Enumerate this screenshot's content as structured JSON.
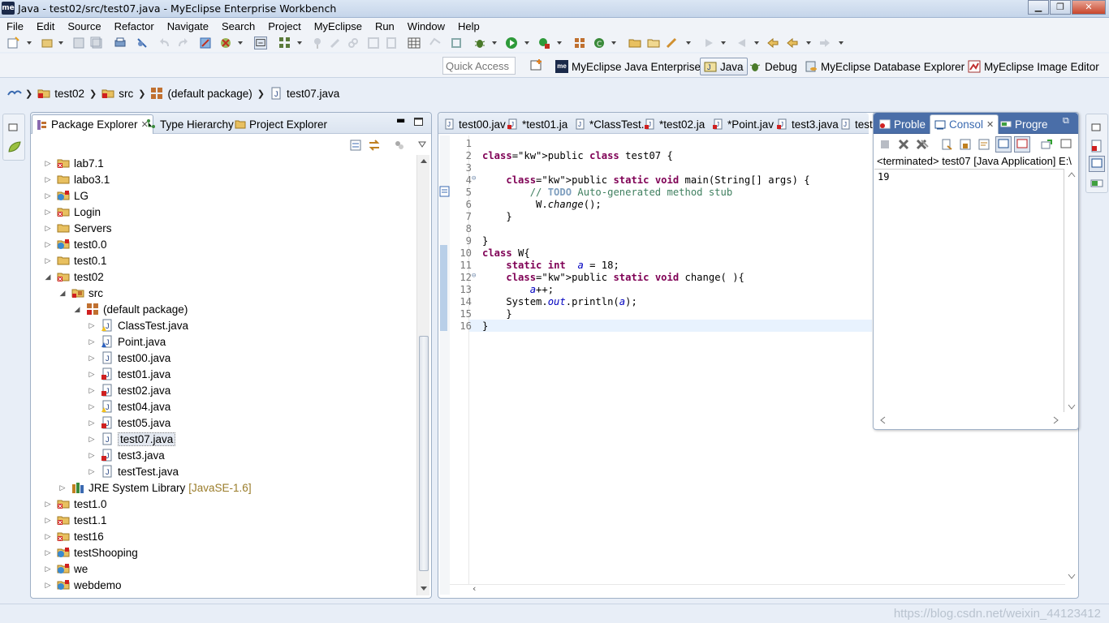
{
  "window": {
    "app_logo": "me",
    "title": "Java - test02/src/test07.java - MyEclipse Enterprise Workbench",
    "minimize": "▁",
    "maximize": "❐",
    "close": "✕"
  },
  "menu": [
    "File",
    "Edit",
    "Source",
    "Refactor",
    "Navigate",
    "Search",
    "Project",
    "MyEclipse",
    "Run",
    "Window",
    "Help"
  ],
  "quick_access": {
    "placeholder": "Quick Access"
  },
  "perspectives": [
    {
      "label": "MyEclipse Java Enterprise",
      "icon": "myeclipse-icon"
    },
    {
      "label": "Java",
      "icon": "java-perspective-icon",
      "active": true
    },
    {
      "label": "Debug",
      "icon": "debug-icon"
    },
    {
      "label": "MyEclipse Database Explorer",
      "icon": "database-icon"
    },
    {
      "label": "MyEclipse Image Editor",
      "icon": "image-editor-icon"
    }
  ],
  "breadcrumb": [
    "test02",
    "src",
    "(default package)",
    "test07.java"
  ],
  "package_explorer": {
    "tabs": [
      "Package Explorer",
      "Type Hierarchy",
      "Project Explorer"
    ],
    "tree": [
      {
        "label": "lab7.1",
        "level": 0,
        "expanded": false,
        "icon": "project-error"
      },
      {
        "label": "labo3.1",
        "level": 0,
        "expanded": false,
        "icon": "project"
      },
      {
        "label": "LG",
        "level": 0,
        "expanded": false,
        "icon": "project-web"
      },
      {
        "label": "Login",
        "level": 0,
        "expanded": false,
        "icon": "project-error"
      },
      {
        "label": "Servers",
        "level": 0,
        "expanded": false,
        "icon": "project"
      },
      {
        "label": "test0.0",
        "level": 0,
        "expanded": false,
        "icon": "project-web"
      },
      {
        "label": "test0.1",
        "level": 0,
        "expanded": false,
        "icon": "project"
      },
      {
        "label": "test02",
        "level": 0,
        "expanded": true,
        "icon": "project-error"
      },
      {
        "label": "src",
        "level": 1,
        "expanded": true,
        "icon": "src-error"
      },
      {
        "label": "(default package)",
        "level": 2,
        "expanded": true,
        "icon": "package-error"
      },
      {
        "label": "ClassTest.java",
        "level": 3,
        "expanded": false,
        "icon": "java-warn"
      },
      {
        "label": "Point.java",
        "level": 3,
        "expanded": false,
        "icon": "java-blue"
      },
      {
        "label": "test00.java",
        "level": 3,
        "expanded": false,
        "icon": "java"
      },
      {
        "label": "test01.java",
        "level": 3,
        "expanded": false,
        "icon": "java-error"
      },
      {
        "label": "test02.java",
        "level": 3,
        "expanded": false,
        "icon": "java-error"
      },
      {
        "label": "test04.java",
        "level": 3,
        "expanded": false,
        "icon": "java-warn"
      },
      {
        "label": "test05.java",
        "level": 3,
        "expanded": false,
        "icon": "java-error"
      },
      {
        "label": "test07.java",
        "level": 3,
        "expanded": false,
        "icon": "java",
        "selected": true
      },
      {
        "label": "test3.java",
        "level": 3,
        "expanded": false,
        "icon": "java-error"
      },
      {
        "label": "testTest.java",
        "level": 3,
        "expanded": false,
        "icon": "java"
      },
      {
        "label": "JRE System Library",
        "suffix": "[JavaSE-1.6]",
        "level": 1,
        "expanded": false,
        "icon": "library"
      },
      {
        "label": "test1.0",
        "level": 0,
        "expanded": false,
        "icon": "project-error"
      },
      {
        "label": "test1.1",
        "level": 0,
        "expanded": false,
        "icon": "project-error"
      },
      {
        "label": "test16",
        "level": 0,
        "expanded": false,
        "icon": "project-error"
      },
      {
        "label": "testShooping",
        "level": 0,
        "expanded": false,
        "icon": "project-web"
      },
      {
        "label": "we",
        "level": 0,
        "expanded": false,
        "icon": "project-web"
      },
      {
        "label": "webdemo",
        "level": 0,
        "expanded": false,
        "icon": "project-web"
      }
    ]
  },
  "editor": {
    "tabs": [
      "test00.jav",
      "*test01.ja",
      "*ClassTest.",
      "*test02.ja",
      "*Point.jav",
      "test3.java",
      "test"
    ],
    "lines": [
      "",
      "public class test07 {",
      "",
      "    public static void main(String[] args) {",
      "        // TODO Auto-generated method stub",
      "         W.change();",
      "    }",
      "",
      "}",
      "class W{",
      "    static int  a = 18;",
      "    public static void change( ){",
      "        a++;",
      "    System.out.println(a);",
      "    }",
      "}"
    ]
  },
  "console": {
    "tabs": [
      "Proble",
      "Consol",
      "Progre"
    ],
    "header": "<terminated> test07 [Java Application] E:\\",
    "output": "19"
  },
  "watermark": "https://blog.csdn.net/weixin_44123412"
}
